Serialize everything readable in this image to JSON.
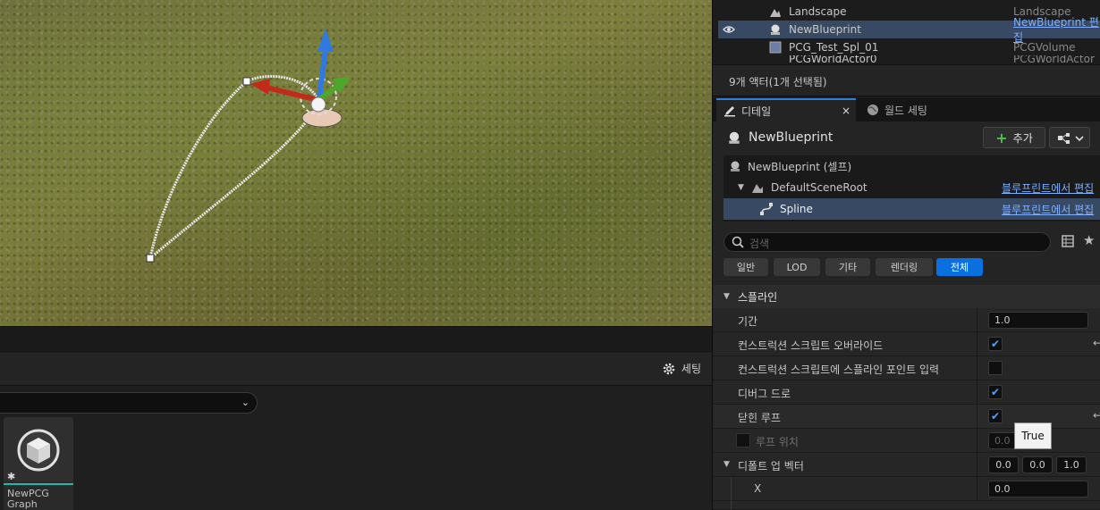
{
  "outliner": {
    "rows": [
      {
        "name": "Landscape",
        "type": "Landscape"
      },
      {
        "name": "NewBlueprint",
        "type": "NewBlueprint 편집"
      },
      {
        "name": "PCG_Test_Spl_01",
        "type": "PCGVolume"
      },
      {
        "name": "PCGWorldActor0",
        "type": "PCGWorldActor"
      }
    ],
    "footer": "9개 액터(1개 선택됨)"
  },
  "tabs": {
    "details": "디테일",
    "world_settings": "월드 세팅"
  },
  "details": {
    "actor_name": "NewBlueprint",
    "add_label": "추가",
    "components": [
      {
        "label": "NewBlueprint (셀프)",
        "link": ""
      },
      {
        "label": "DefaultSceneRoot",
        "link": "블루프린트에서 편집"
      },
      {
        "label": "Spline",
        "link": "블루프린트에서 편집"
      }
    ],
    "search_placeholder": "검색",
    "filters": [
      "일반",
      "LOD",
      "기타",
      "렌더링",
      "전체"
    ],
    "active_filter": "전체",
    "category": "스플라인",
    "props": {
      "duration": {
        "label": "기간",
        "value": "1.0"
      },
      "cs_override": {
        "label": "컨스트럭션 스크립트 오버라이드",
        "checked": true
      },
      "cs_input": {
        "label": "컨스트럭션 스크립트에 스플라인 포인트 입력",
        "checked": false
      },
      "debug_draw": {
        "label": "디버그 드로",
        "checked": true
      },
      "closed_loop": {
        "label": "닫힌 루프",
        "checked": true
      },
      "loop_position": {
        "label": "루프 위치",
        "value": "0.0"
      },
      "default_up": {
        "label": "디폴트 업 벡터",
        "x": "0.0",
        "y": "0.0",
        "z": "1.0"
      },
      "x": {
        "label": "X",
        "value": "0.0"
      }
    },
    "tooltip": "True"
  },
  "content_browser": {
    "settings_label": "세팅",
    "asset_name": "NewPCG Graph"
  },
  "colors": {
    "selection": "#384a63",
    "accent": "#0a70e0",
    "link": "#7fb0ff"
  }
}
